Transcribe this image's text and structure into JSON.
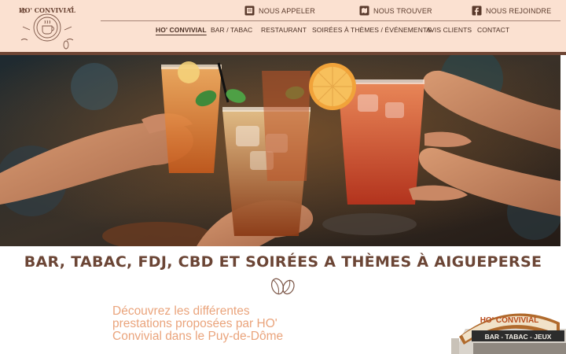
{
  "header": {
    "logo": {
      "name": "HO' CONVIVIAL",
      "text": "HO' CONVIVIAL"
    },
    "contact_links": [
      {
        "label": "NOUS APPELER",
        "icon": "phone-book-icon"
      },
      {
        "label": "NOUS TROUVER",
        "icon": "map-icon"
      },
      {
        "label": "NOUS REJOINDRE",
        "icon": "facebook-icon"
      }
    ]
  },
  "nav": {
    "items": [
      {
        "label": "HO' CONVIVIAL",
        "active": true
      },
      {
        "label": "BAR / TABAC",
        "active": false
      },
      {
        "label": "RESTAURANT",
        "active": false
      },
      {
        "label": "SOIRÉES À THÈMES / ÉVÉNEMENTS",
        "active": false
      },
      {
        "label": "AVIS CLIENTS",
        "active": false
      },
      {
        "label": "CONTACT",
        "active": false
      }
    ]
  },
  "main": {
    "headline": "BAR, TABAC, FDJ, CBD ET SOIRÉES A THÈMES À AIGUEPERSE",
    "intro": "Découvrez les différentes prestations proposées par HO' Convivial dans le Puy-de-Dôme",
    "storefront_sign": {
      "title": "HO' CONVIVIAL",
      "subtitle": "BAR - TABAC - JEUX"
    }
  },
  "colors": {
    "header_bg": "#fbe1d1",
    "header_border": "#6e4534",
    "brand_brown": "#6b4535",
    "intro_orange": "#eaa47c"
  }
}
